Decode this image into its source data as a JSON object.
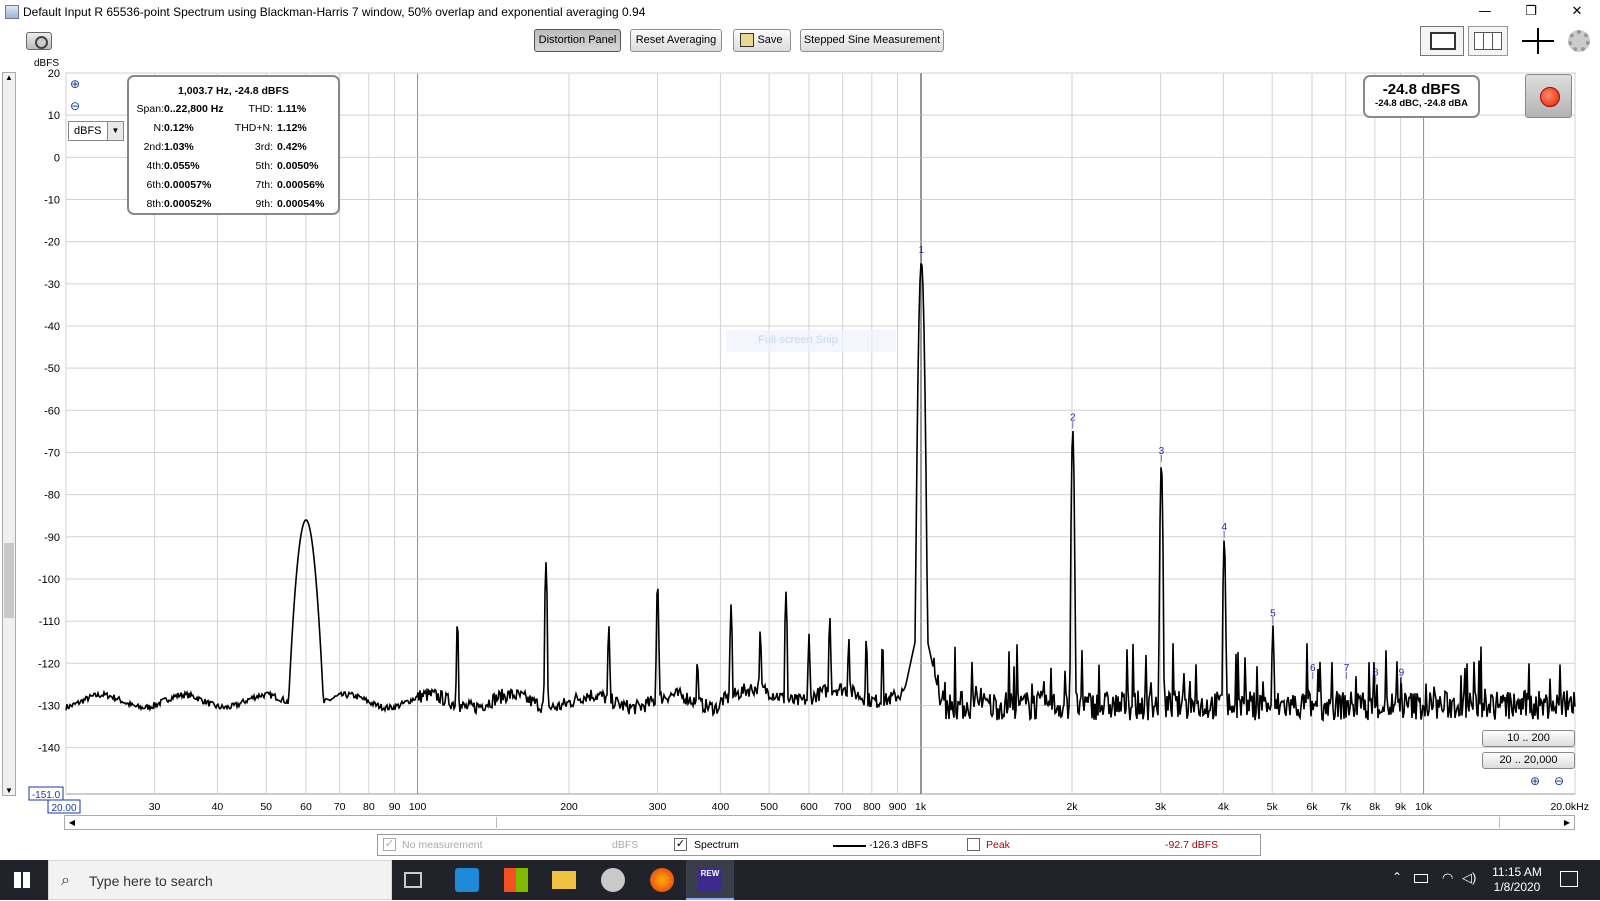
{
  "window": {
    "title": "Default Input R 65536-point Spectrum using Blackman-Harris 7 window, 50% overlap and exponential averaging 0.94",
    "minimize": "—",
    "restore": "❐",
    "close": "✕"
  },
  "toolbar": {
    "distortion_panel": "Distortion Panel",
    "reset_averaging": "Reset Averaging",
    "save": "Save",
    "stepped_sine": "Stepped Sine Measurement"
  },
  "plot": {
    "y_unit": "dBFS",
    "unit_select": "dBFS",
    "y_min_label": "-151.0",
    "x_min_label": "20.00",
    "watermark": "Full-screen Snip",
    "range_buttons": [
      "10 .. 200",
      "20 .. 20,000"
    ],
    "colors": {
      "trace": "#000000",
      "grid": "#c8c8c8",
      "marker": "#1f1fb0",
      "record": "#e02000"
    }
  },
  "info": {
    "header": "1,003.7 Hz, -24.8 dBFS",
    "rows": [
      [
        "Span:",
        "0..22,800 Hz",
        "THD:",
        "1.11%"
      ],
      [
        "N:",
        "0.12%",
        "THD+N:",
        "1.12%"
      ],
      [
        "2nd:",
        "1.03%",
        "3rd:",
        "0.42%"
      ],
      [
        "4th:",
        "0.055%",
        "5th:",
        "0.0050%"
      ],
      [
        "6th:",
        "0.00057%",
        "7th:",
        "0.00056%"
      ],
      [
        "8th:",
        "0.00052%",
        "9th:",
        "0.00054%"
      ]
    ]
  },
  "level": {
    "main": "-24.8 dBFS",
    "sub": "-24.8 dBC, -24.8 dBA"
  },
  "legend": {
    "no_measurement": "No measurement",
    "no_measurement_unit": "dBFS",
    "spectrum": "Spectrum",
    "spectrum_value": "-126.3 dBFS",
    "peak": "Peak",
    "peak_value": "-92.7 dBFS"
  },
  "taskbar": {
    "search_placeholder": "Type here to search",
    "time": "11:15 AM",
    "date": "1/8/2020"
  },
  "chart_data": {
    "type": "line",
    "xlabel": "",
    "ylabel": "dBFS",
    "x_scale": "log",
    "xlim": [
      20,
      20000
    ],
    "ylim": [
      -151,
      20
    ],
    "grid": true,
    "y_ticks": [
      20,
      10,
      0,
      -10,
      -20,
      -30,
      -40,
      -50,
      -60,
      -70,
      -80,
      -90,
      -100,
      -110,
      -120,
      -130,
      -140
    ],
    "x_ticks": [
      {
        "v": 30,
        "l": "30"
      },
      {
        "v": 40,
        "l": "40"
      },
      {
        "v": 50,
        "l": "50"
      },
      {
        "v": 60,
        "l": "60"
      },
      {
        "v": 70,
        "l": "70"
      },
      {
        "v": 80,
        "l": "80"
      },
      {
        "v": 90,
        "l": "90"
      },
      {
        "v": 100,
        "l": "100"
      },
      {
        "v": 200,
        "l": "200"
      },
      {
        "v": 300,
        "l": "300"
      },
      {
        "v": 400,
        "l": "400"
      },
      {
        "v": 500,
        "l": "500"
      },
      {
        "v": 600,
        "l": "600"
      },
      {
        "v": 700,
        "l": "700"
      },
      {
        "v": 800,
        "l": "800"
      },
      {
        "v": 900,
        "l": "900"
      },
      {
        "v": 1000,
        "l": "1k"
      },
      {
        "v": 2000,
        "l": "2k"
      },
      {
        "v": 3000,
        "l": "3k"
      },
      {
        "v": 4000,
        "l": "4k"
      },
      {
        "v": 5000,
        "l": "5k"
      },
      {
        "v": 6000,
        "l": "6k"
      },
      {
        "v": 7000,
        "l": "7k"
      },
      {
        "v": 8000,
        "l": "8k"
      },
      {
        "v": 9000,
        "l": "9k"
      },
      {
        "v": 10000,
        "l": "10k"
      },
      {
        "v": 20000,
        "l": "20.0kHz"
      }
    ],
    "series": [
      {
        "name": "Spectrum",
        "floor_db": -129,
        "peaks": [
          {
            "f": 60,
            "db": -86
          },
          {
            "f": 120,
            "db": -110
          },
          {
            "f": 180,
            "db": -96
          },
          {
            "f": 240,
            "db": -111
          },
          {
            "f": 300,
            "db": -101
          },
          {
            "f": 360,
            "db": -119
          },
          {
            "f": 420,
            "db": -106
          },
          {
            "f": 480,
            "db": -112
          },
          {
            "f": 540,
            "db": -103
          },
          {
            "f": 600,
            "db": -113
          },
          {
            "f": 660,
            "db": -109
          },
          {
            "f": 720,
            "db": -114
          },
          {
            "f": 780,
            "db": -114
          },
          {
            "f": 840,
            "db": -115
          },
          {
            "f": 1003.7,
            "db": -24.8
          },
          {
            "f": 2007,
            "db": -64.5
          },
          {
            "f": 3011,
            "db": -72.5
          },
          {
            "f": 4015,
            "db": -90.5
          },
          {
            "f": 5018,
            "db": -111
          }
        ]
      }
    ],
    "harmonic_markers": [
      {
        "label": "1",
        "f": 1003.7,
        "db": -24.8
      },
      {
        "label": "2",
        "f": 2007,
        "db": -64.5
      },
      {
        "label": "3",
        "f": 3011,
        "db": -72.5
      },
      {
        "label": "4",
        "f": 4015,
        "db": -90.5
      },
      {
        "label": "5",
        "f": 5018,
        "db": -111
      },
      {
        "label": "6",
        "f": 6022,
        "db": -124
      },
      {
        "label": "7",
        "f": 7026,
        "db": -124
      },
      {
        "label": "8",
        "f": 8030,
        "db": -125
      },
      {
        "label": "9",
        "f": 9033,
        "db": -125
      }
    ]
  }
}
